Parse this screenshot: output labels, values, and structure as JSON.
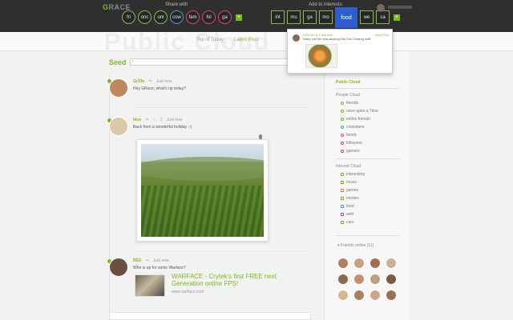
{
  "topbar": {
    "logo_first": "G",
    "logo_rest": "RACE",
    "share_label": "Share with",
    "interests_label": "Add to interests",
    "circles": [
      {
        "label": "fri",
        "color": "#8ab84a"
      },
      {
        "label": "onc",
        "color": "#8ab84a"
      },
      {
        "label": "onl",
        "color": "#8ab84a"
      },
      {
        "label": "cow",
        "color": "#4c9ad6"
      },
      {
        "label": "fam",
        "color": "#e0407a"
      },
      {
        "label": "fol",
        "color": "#e0407a"
      },
      {
        "label": "ga",
        "color": "#e0407a"
      }
    ],
    "circles_add": "+",
    "squares": [
      "int",
      "mu",
      "ga",
      "mo",
      "food",
      "we",
      "ca"
    ],
    "squares_active_index": 4,
    "squares_add": "+"
  },
  "header": {
    "ghost_title": "Public Cloud",
    "nav_top": "Top of Today",
    "nav_latest": "Latest Post"
  },
  "feed": {
    "seed_title": "Seed",
    "seed_input_value": "I",
    "posts": [
      {
        "author": "Gr33n",
        "time": "Just now",
        "text": "Hey GRace, what's up today?",
        "avatar_color": "#c08860"
      },
      {
        "author": "blue",
        "fav_count": "2",
        "time": "Just now",
        "text": "Back from a wonderful holiday :-)",
        "avatar_color": "#d9c9a8"
      },
      {
        "author": "RED",
        "time": "Just now",
        "text": "Who is up for some Warface?",
        "avatar_color": "#6a5040",
        "link_title": "WARFACE - Crytek's first FREE next Generation online FPS!",
        "link_url": "www.warface.com"
      }
    ]
  },
  "popup": {
    "author": "Gr33n",
    "meta": "Gr33n  3m  ★ 3  Just now",
    "link": "Latest Post",
    "text": "Today I had the most amazing Pad Thai. Amazing stuff!"
  },
  "sidebar": {
    "public_cloud": "Public Cloud",
    "people_cloud": "People Cloud",
    "people": [
      {
        "label": "friends",
        "color": "#7cba1c"
      },
      {
        "label": "once upon a Time",
        "color": "#7cba1c"
      },
      {
        "label": "online friends",
        "color": "#7cba1c"
      },
      {
        "label": "coworkers",
        "color": "#4c9ad6"
      },
      {
        "label": "family",
        "color": "#e0407a"
      },
      {
        "label": "followers",
        "color": "#e0407a"
      },
      {
        "label": "gamers",
        "color": "#e0407a"
      }
    ],
    "interest_cloud": "Interest Cloud",
    "interests": [
      {
        "label": "interesting",
        "color": "#7cba1c"
      },
      {
        "label": "music",
        "color": "#7cba1c"
      },
      {
        "label": "games",
        "color": "#e08a30"
      },
      {
        "label": "movies",
        "color": "#7cba1c"
      },
      {
        "label": "food",
        "color": "#4c9ad6"
      },
      {
        "label": "web",
        "color": "#e0407a"
      },
      {
        "label": "cars",
        "color": "#7cba1c"
      }
    ],
    "friends_online": "Friends online (11)",
    "friend_colors": [
      "#b28060",
      "#c9a080",
      "#a07050",
      "#d0b090",
      "#8a6a50",
      "#c09070",
      "#b8a080",
      "#7a5a40",
      "#d6b890",
      "#a88060",
      "#c8a888",
      "#9a7050"
    ]
  }
}
